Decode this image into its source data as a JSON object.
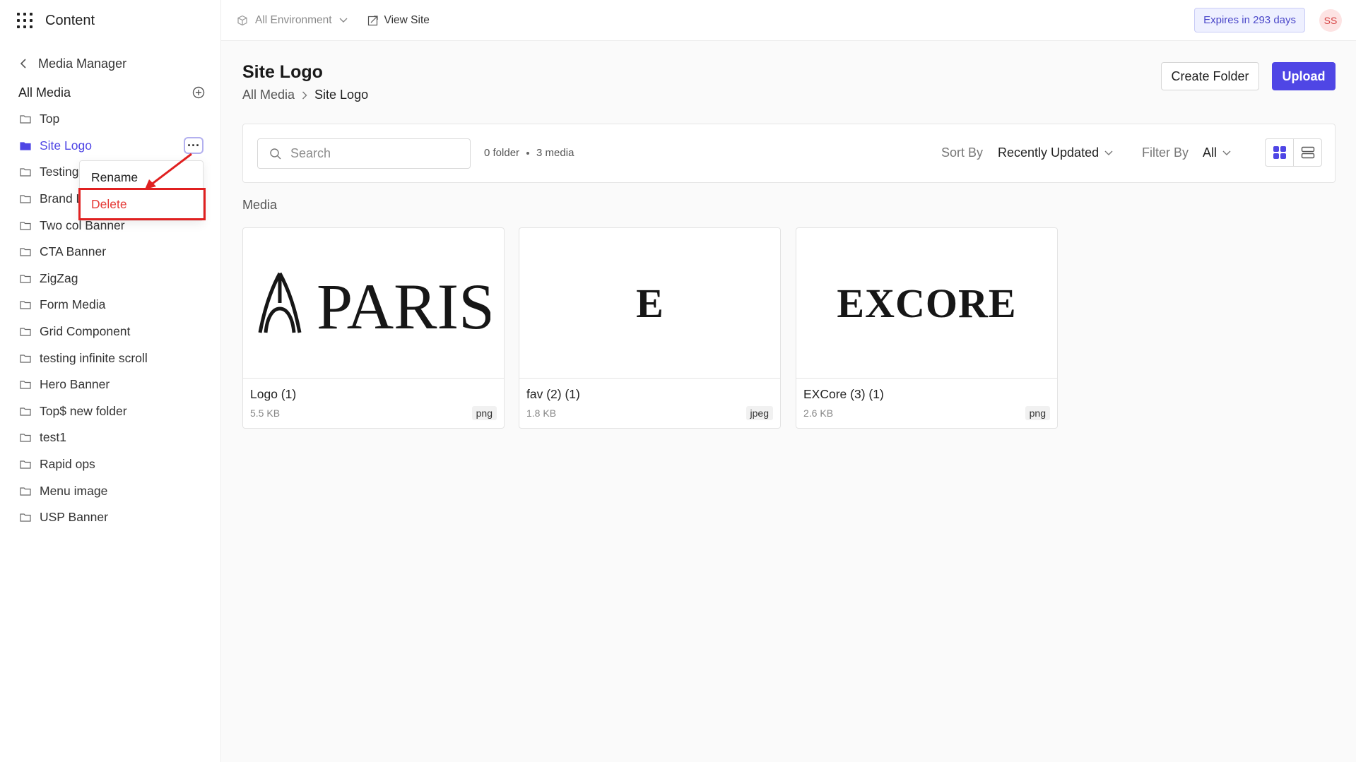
{
  "sidebar": {
    "app_title": "Content",
    "back_label": "Media Manager",
    "all_media_label": "All Media",
    "folders": [
      {
        "label": "Top",
        "active": false
      },
      {
        "label": "Site Logo",
        "active": true
      },
      {
        "label": "Testing",
        "active": false
      },
      {
        "label": "Brand L",
        "active": false
      },
      {
        "label": "Two col Banner",
        "active": false
      },
      {
        "label": "CTA Banner",
        "active": false
      },
      {
        "label": "ZigZag",
        "active": false
      },
      {
        "label": "Form Media",
        "active": false
      },
      {
        "label": "Grid Component",
        "active": false
      },
      {
        "label": "testing infinite scroll",
        "active": false
      },
      {
        "label": "Hero Banner",
        "active": false
      },
      {
        "label": "Top$ new folder",
        "active": false
      },
      {
        "label": "test1",
        "active": false
      },
      {
        "label": "Rapid ops",
        "active": false
      },
      {
        "label": "Menu image",
        "active": false
      },
      {
        "label": "USP Banner",
        "active": false
      }
    ],
    "more_label": "···"
  },
  "context_menu": {
    "rename": "Rename",
    "delete": "Delete"
  },
  "topbar": {
    "environment": "All Environment",
    "view_site": "View Site",
    "expires": "Expires in 293 days",
    "avatar_initials": "SS"
  },
  "main": {
    "title": "Site Logo",
    "breadcrumb": [
      "All Media",
      "Site Logo"
    ],
    "create_folder_label": "Create Folder",
    "upload_label": "Upload",
    "search_placeholder": "Search",
    "folder_count": "0 folder",
    "media_count": "3 media",
    "sort_label": "Sort By",
    "sort_value": "Recently Updated",
    "filter_label": "Filter By",
    "filter_value": "All",
    "section_label": "Media",
    "media": [
      {
        "name": "Logo (1)",
        "size": "5.5 KB",
        "type": "png",
        "logo": "PARIS"
      },
      {
        "name": "fav (2) (1)",
        "size": "1.8 KB",
        "type": "jpeg",
        "logo": "E"
      },
      {
        "name": "EXCore (3) (1)",
        "size": "2.6 KB",
        "type": "png",
        "logo": "EXCORE"
      }
    ]
  },
  "colors": {
    "accent": "#4f46e5",
    "danger": "#e53935",
    "highlight": "#e02020"
  }
}
